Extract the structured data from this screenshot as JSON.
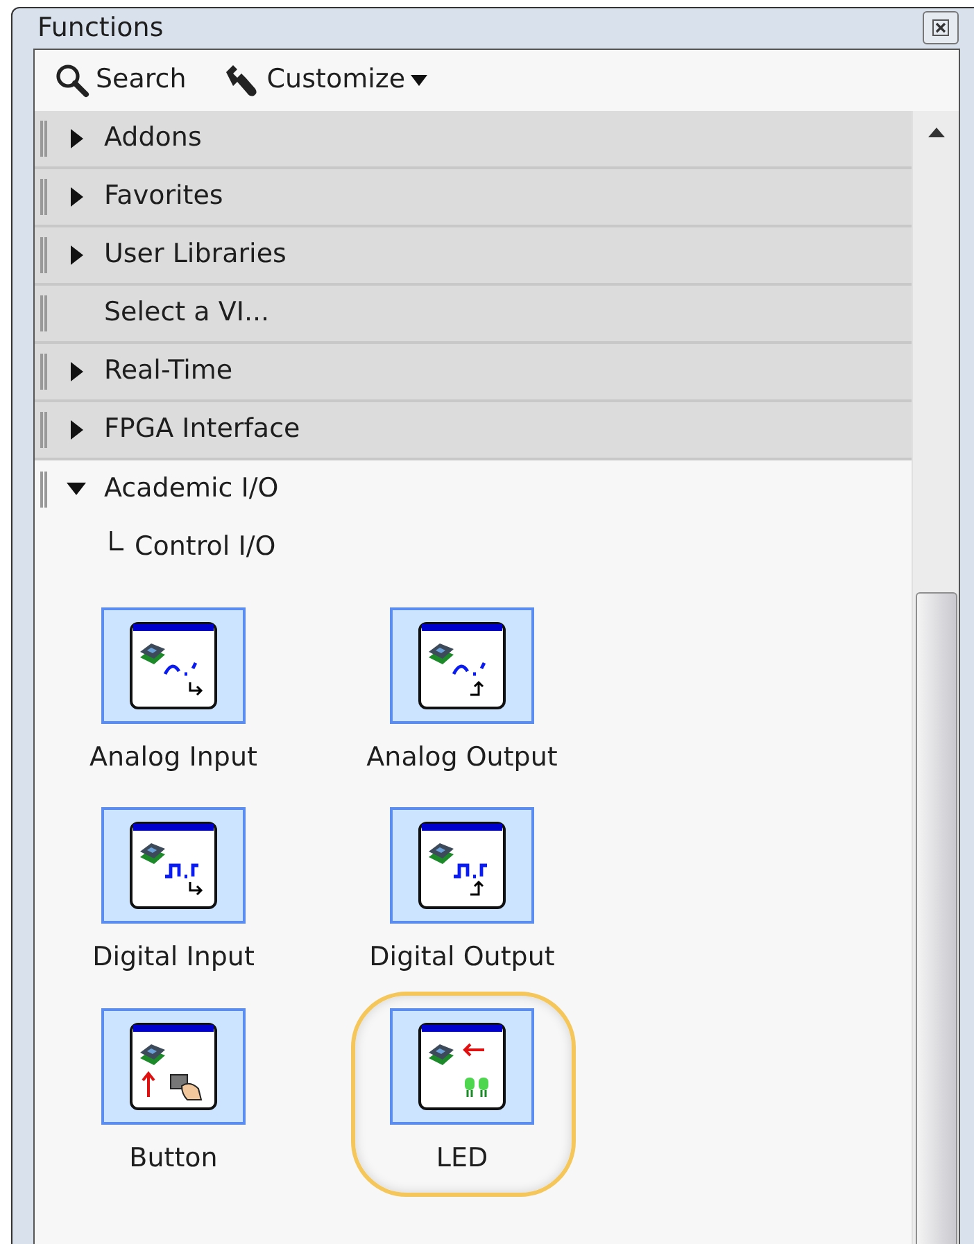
{
  "window": {
    "title": "Functions"
  },
  "toolbar": [
    {
      "label": "Search",
      "kind": "search"
    },
    {
      "label": "Customize",
      "kind": "customize"
    }
  ],
  "categories": [
    {
      "label": "Addons",
      "kind": "folder",
      "expanded": false
    },
    {
      "label": "Favorites",
      "kind": "folder",
      "expanded": false
    },
    {
      "label": "User Libraries",
      "kind": "folder",
      "expanded": false
    },
    {
      "label": "Select a VI...",
      "kind": "item",
      "expanded": false
    },
    {
      "label": "Real-Time",
      "kind": "folder",
      "expanded": false
    },
    {
      "label": "FPGA Interface",
      "kind": "folder",
      "expanded": false
    },
    {
      "label": "Academic I/O",
      "kind": "folder",
      "expanded": true,
      "children": [
        {
          "label": "Control I/O"
        }
      ]
    }
  ],
  "palette": [
    {
      "label": "Analog Input",
      "kind": "analog_input",
      "highlighted": false
    },
    {
      "label": "Analog Output",
      "kind": "analog_output",
      "highlighted": false
    },
    {
      "label": "Digital Input",
      "kind": "digital_input",
      "highlighted": false
    },
    {
      "label": "Digital Output",
      "kind": "digital_output",
      "highlighted": false
    },
    {
      "label": "Button",
      "kind": "button",
      "highlighted": false
    },
    {
      "label": "LED",
      "kind": "led",
      "highlighted": true
    }
  ]
}
